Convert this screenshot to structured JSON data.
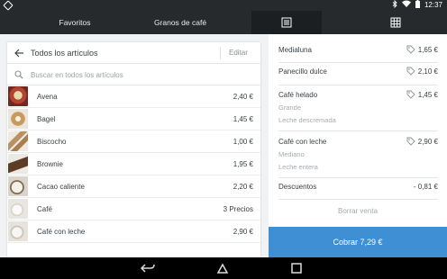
{
  "status_bar": {
    "time": "12:37",
    "icons": [
      "bluetooth-icon",
      "wifi-icon",
      "battery-icon"
    ]
  },
  "tabs": [
    {
      "label": "Favoritos"
    },
    {
      "label": "Granos de café"
    }
  ],
  "view_toggles": [
    "list-view-icon",
    "grid-view-icon"
  ],
  "library": {
    "title": "Todos los artículos",
    "edit_label": "Editar",
    "search_placeholder": "Buscar en todos los artículos",
    "items": [
      {
        "name": "Avena",
        "price": "2,40 €",
        "thumb_color": "#b5432f"
      },
      {
        "name": "Bagel",
        "price": "1,45 €",
        "thumb_color": "#c99a5b"
      },
      {
        "name": "Biscocho",
        "price": "1,00 €",
        "thumb_color": "#b9905f"
      },
      {
        "name": "Brownie",
        "price": "1,95 €",
        "thumb_color": "#5e3b25"
      },
      {
        "name": "Cacao caliente",
        "price": "2,20 €",
        "thumb_color": "#8a6a4f"
      },
      {
        "name": "Café",
        "price": "3 Precios",
        "thumb_color": "#d8d3cc"
      },
      {
        "name": "Café con leche",
        "price": "2,90 €",
        "thumb_color": "#cfc4b4"
      }
    ]
  },
  "sale": {
    "items": [
      {
        "name": "Medialuna",
        "price": "1,65 €",
        "modifiers": []
      },
      {
        "name": "Panecillo dulce",
        "price": "2,10 €",
        "modifiers": []
      },
      {
        "name": "Café helado",
        "price": "1,45 €",
        "modifiers": [
          "Grande",
          "Leche descremada"
        ]
      },
      {
        "name": "Café con leche",
        "price": "2,90 €",
        "modifiers": [
          "Mediano",
          "Leche entera"
        ]
      }
    ],
    "discount_label": "Descuentos",
    "discount_value": "- 0,81 €",
    "clear_label": "Borrar venta",
    "charge_label": "Cobrar 7,29 €",
    "accent_color": "#3e8fd4"
  },
  "nav_bar": [
    "back-icon",
    "home-icon",
    "recents-icon"
  ]
}
